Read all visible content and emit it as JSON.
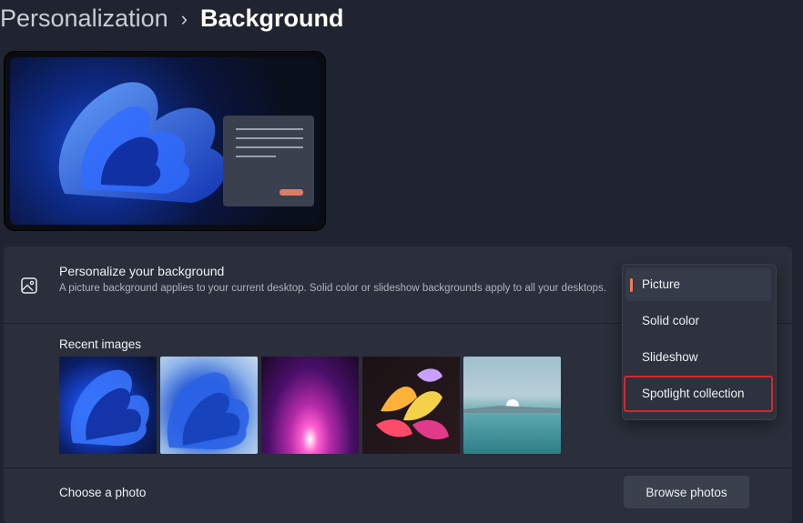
{
  "header": {
    "breadcrumb_parent": "Personalization",
    "separator": "›",
    "page_title": "Background"
  },
  "personalize": {
    "title": "Personalize your background",
    "description": "A picture background applies to your current desktop. Solid color or slideshow backgrounds apply to all your desktops.",
    "icon": "image-icon"
  },
  "recent_images": {
    "label": "Recent images",
    "items": [
      "bloom-dark-blue",
      "bloom-light-blue",
      "purple-glow",
      "abstract-flower",
      "lake-sunrise"
    ]
  },
  "choose_photo": {
    "label": "Choose a photo",
    "button_label": "Browse photos"
  },
  "dropdown": {
    "options": [
      {
        "label": "Picture",
        "selected": true
      },
      {
        "label": "Solid color",
        "selected": false
      },
      {
        "label": "Slideshow",
        "selected": false
      },
      {
        "label": "Spotlight collection",
        "selected": false,
        "highlighted": true
      }
    ]
  },
  "colors": {
    "background": "#1f2430",
    "card": "#2a2f3b",
    "accent": "#f07a5e",
    "highlight_box": "#d8262a"
  }
}
